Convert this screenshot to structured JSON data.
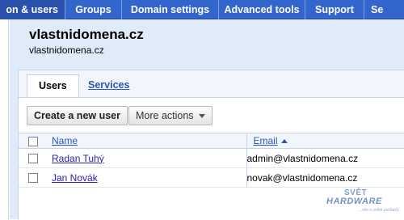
{
  "nav": {
    "tabs": [
      {
        "label": "on & users",
        "active": true
      },
      {
        "label": "Groups",
        "active": false
      },
      {
        "label": "Domain settings",
        "active": false
      },
      {
        "label": "Advanced tools",
        "active": false
      },
      {
        "label": "Support",
        "active": false
      },
      {
        "label": "Se",
        "active": false
      }
    ]
  },
  "header": {
    "domain_title": "vlastnidomena.cz",
    "domain_subtitle": "vlastnidomena.cz"
  },
  "subtabs": {
    "users": "Users",
    "services": "Services"
  },
  "toolbar": {
    "create_label": "Create a new user",
    "more_label": "More actions"
  },
  "table": {
    "columns": {
      "name": "Name",
      "email": "Email"
    },
    "sort": {
      "column": "email",
      "direction": "ascending"
    },
    "rows": [
      {
        "name": "Radan Tuhý",
        "email": "admin@vlastnidomena.cz"
      },
      {
        "name": "Jan Novák",
        "email": "novak@vlastnidomena.cz"
      }
    ]
  },
  "watermark": {
    "top": "SVĚT",
    "main": "HARDWARE",
    "sub": "...vše o světě počítačů"
  },
  "colors": {
    "nav_blue": "#3366cc",
    "header_bg": "#e0ebf9",
    "link_blue": "#2a55b8"
  }
}
